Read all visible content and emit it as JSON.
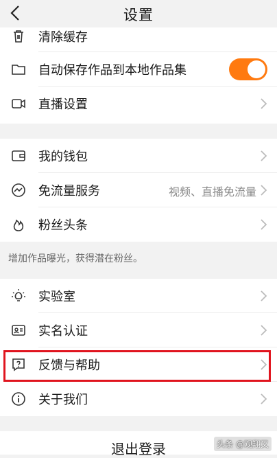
{
  "header": {
    "title": "设置"
  },
  "group1": [
    {
      "id": "clear-cache",
      "label": "清除缓存",
      "icon": "trash-icon"
    },
    {
      "id": "autosave",
      "label": "自动保存作品到本地作品集",
      "icon": "folder-icon",
      "toggle_on": true
    },
    {
      "id": "live-settings",
      "label": "直播设置",
      "icon": "video-camera-icon"
    }
  ],
  "group2": [
    {
      "id": "wallet",
      "label": "我的钱包",
      "icon": "wallet-icon"
    },
    {
      "id": "data-free",
      "label": "免流量服务",
      "value": "视频、直播免流量",
      "icon": "traffic-icon"
    },
    {
      "id": "fans-headline",
      "label": "粉丝头条",
      "icon": "flame-icon"
    }
  ],
  "hint": "增加作品曝光，获得潜在粉丝。",
  "group3": [
    {
      "id": "lab",
      "label": "实验室",
      "icon": "lightbulb-icon"
    },
    {
      "id": "verification",
      "label": "实名认证",
      "icon": "id-card-icon"
    },
    {
      "id": "feedback",
      "label": "反馈与帮助",
      "icon": "help-bubble-icon"
    },
    {
      "id": "about",
      "label": "关于我们",
      "icon": "info-icon"
    }
  ],
  "logout": "退出登录",
  "watermark": "头条 @观翔又",
  "colors": {
    "accent": "#ff7a10",
    "highlight": "#e0141e",
    "background": "#f2f2f2"
  }
}
